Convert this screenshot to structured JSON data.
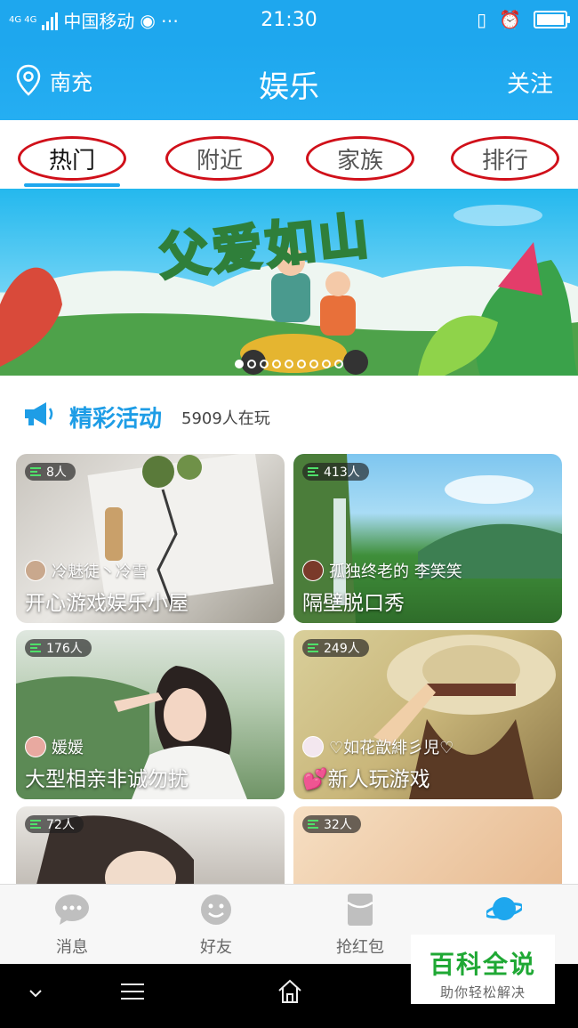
{
  "status_bar": {
    "carrier": "中国移动",
    "net_label": "4G 4G",
    "time": "21:30",
    "extra": "⋯"
  },
  "header": {
    "location": "南充",
    "title": "娱乐",
    "follow_label": "关注"
  },
  "tabs": [
    {
      "label": "热门",
      "active": true
    },
    {
      "label": "附近",
      "active": false
    },
    {
      "label": "家族",
      "active": false
    },
    {
      "label": "排行",
      "active": false
    }
  ],
  "banner": {
    "title": "父爱如山",
    "dot_count": 9,
    "active_dot": 0
  },
  "section": {
    "title": "精彩活动",
    "online_count": "5909人在玩"
  },
  "rooms": [
    {
      "count": "8人",
      "host": "冷魅徒丶冷雪",
      "name": "开心游戏娱乐小屋"
    },
    {
      "count": "413人",
      "host": "孤独终老的    李笑笑",
      "name": "隔壁脱口秀"
    },
    {
      "count": "176人",
      "host": "媛媛",
      "name": "大型相亲非诚勿扰"
    },
    {
      "count": "249人",
      "host": "♡如花歆緋彡児♡",
      "name": "新人玩游戏"
    },
    {
      "count": "72人",
      "host": "",
      "name": ""
    },
    {
      "count": "32人",
      "host": "",
      "name": ""
    }
  ],
  "tabbar": [
    {
      "label": "消息",
      "icon": "chat-bubble-icon"
    },
    {
      "label": "好友",
      "icon": "smiley-icon"
    },
    {
      "label": "抢红包",
      "icon": "red-envelope-icon"
    },
    {
      "label": "",
      "icon": "planet-icon"
    }
  ],
  "watermark": {
    "title": "百科全说",
    "subtitle": "助你轻松解决"
  },
  "colors": {
    "brand_blue": "#1ea7ee",
    "annotation_red": "#d0101a",
    "watermark_green": "#1fa834"
  }
}
